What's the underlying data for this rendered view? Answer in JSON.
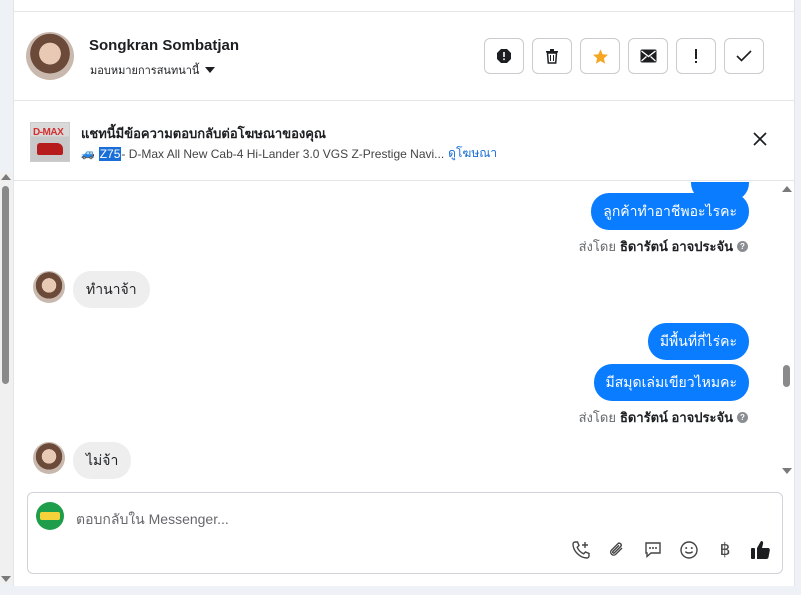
{
  "header": {
    "contact_name": "Songkran Sombatjan",
    "assign_label": "มอบหมายการสนทนานี้",
    "actions": [
      {
        "name": "report-icon",
        "label": "Report"
      },
      {
        "name": "trash-icon",
        "label": "Delete"
      },
      {
        "name": "star-icon",
        "label": "Star"
      },
      {
        "name": "envelope-icon",
        "label": "Mark unread"
      },
      {
        "name": "exclamation-icon",
        "label": "Important"
      },
      {
        "name": "check-icon",
        "label": "Done"
      }
    ]
  },
  "ad": {
    "thumbnail_brand": "D-MAX",
    "title": "แชทนี้มีข้อความตอบกลับต่อโฆษณาของคุณ",
    "code": "Z75",
    "description": " - D-Max All New Cab-4 Hi-Lander 3.0 VGS Z-Prestige Navi...",
    "link_label": "ดูโฆษณา"
  },
  "messages": {
    "out_1": "ลูกค้าทำอาชีพอะไรคะ",
    "sent_by_1_prefix": "ส่งโดย",
    "sent_by_1_name": "ธิดารัตน์ อาจประจัน",
    "in_1": "ทำนาจ้า",
    "out_2": "มีพื้นที่กี่ไร่คะ",
    "out_3": "มีสมุดเล่มเขียวไหมคะ",
    "sent_by_2_prefix": "ส่งโดย",
    "sent_by_2_name": "ธิดารัตน์ อาจประจัน",
    "in_2": "ไม่จ้า"
  },
  "composer": {
    "placeholder": "ตอบกลับใน Messenger...",
    "tools": [
      "phone-add-icon",
      "paperclip-icon",
      "chat-bubble-icon",
      "emoji-icon",
      "baht-icon",
      "thumbs-up-icon"
    ],
    "baht_symbol": "฿"
  },
  "colors": {
    "accent": "#0a7cff",
    "star": "#f5a623",
    "link": "#1a6ed8"
  }
}
